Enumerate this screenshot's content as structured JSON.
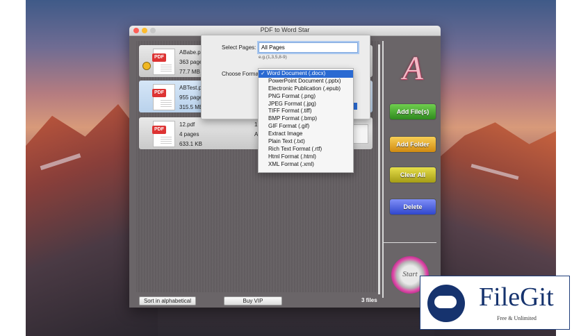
{
  "window": {
    "title": "PDF to Word Star"
  },
  "files": [
    {
      "name": "ABabe.pdf",
      "pages": "363 pages",
      "size": "77.7 MB",
      "selected": false
    },
    {
      "name": "ABTest.pdf",
      "pages": "955 pages",
      "size": "315.5 MB",
      "selected": true
    },
    {
      "name": "12.pdf",
      "pages": "4 pages",
      "size": "633.1 KB",
      "selected": false
    }
  ],
  "file_icon_badge": "PDF",
  "row3_extra": {
    "col2": "12.",
    "col3": "All"
  },
  "sheet": {
    "select_pages_label": "Select Pages:",
    "select_pages_value": "All Pages",
    "pages_hint": "e.g.(1,3,5,8-9)",
    "choose_format_label": "Choose Format:"
  },
  "formats": {
    "selected": "Word Document (.docx)",
    "options": [
      "Word Document (.docx)",
      "PowerPoint Document (.pptx)",
      "Electronic Publication (.epub)",
      "PNG Format (.png)",
      "JPEG Format (.jpg)",
      "TIFF Format (.tiff)",
      "BMP Format (.bmp)",
      "GIF Format (.gif)",
      "Extract Image",
      "Plain Text (.txt)",
      "Rich Text Format (.rtf)",
      "Html Format (.html)",
      "XML Format (.xml)"
    ]
  },
  "sidebar": {
    "add_files": "Add File(s)",
    "add_folder": "Add Folder",
    "clear_all": "Clear All",
    "delete": "Delete",
    "start": "Start",
    "colors": {
      "add_files": "#3a9b2a",
      "add_folder": "#e2a21c",
      "clear_all": "#b7ad1b",
      "delete": "#3f55d8"
    }
  },
  "bottom": {
    "sort_label": "Sort in alphabetical",
    "buy_label": "Buy VIP",
    "count": "3 files"
  },
  "watermark": {
    "name": "FileGit",
    "tagline": "Free & Unlimited"
  }
}
